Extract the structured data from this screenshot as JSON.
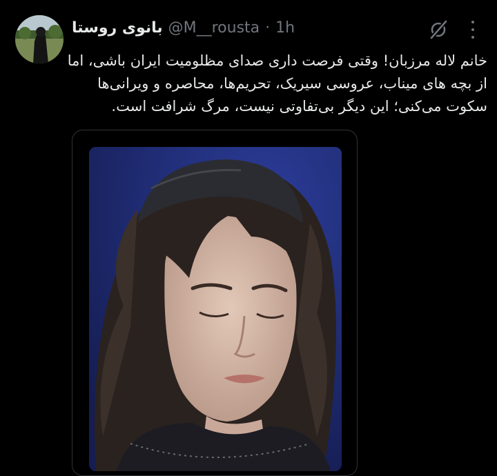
{
  "tweet": {
    "display_name": "بانوی روستا",
    "handle": "@M__rousta",
    "separator": "·",
    "time": "1h",
    "text_lines": [
      "خانم لاله مرزبان! وقتی فرصت داری صدای مظلومیت ایران باشی، اما",
      "از بچه های میناب، عروسی سیریک، تحریم‌ها، محاصره و ویرانی‌ها",
      "سکوت می‌کنی؛ این دیگر بی‌تفاوتی نیست، مرگ شرافت است."
    ]
  },
  "icons": {
    "grok": "grok-icon",
    "more": "more-icon"
  },
  "colors": {
    "background": "#000000",
    "text": "#e7e9ea",
    "secondary": "#71767b",
    "border": "#2f3336",
    "video_backdrop": "#24327a"
  }
}
